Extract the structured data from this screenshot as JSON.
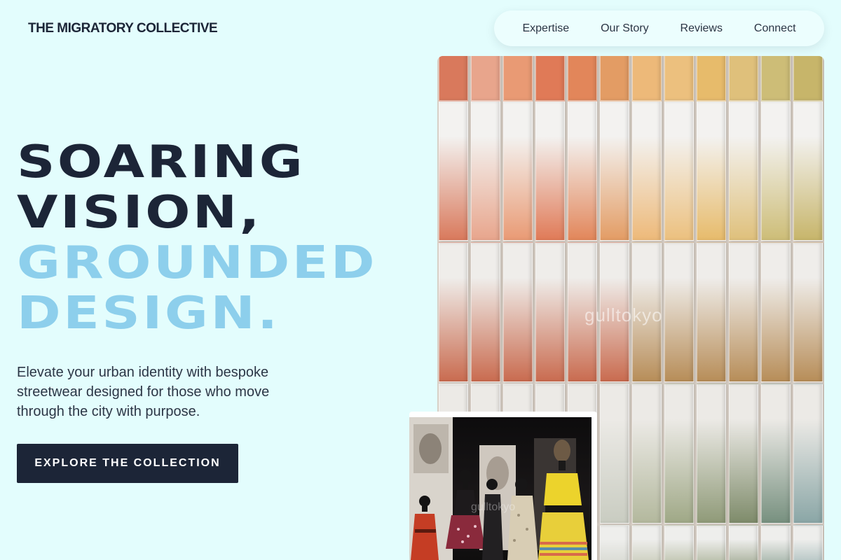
{
  "brand": "THE MIGRATORY COLLECTIVE",
  "nav": {
    "items": [
      {
        "label": "Expertise"
      },
      {
        "label": "Our Story"
      },
      {
        "label": "Reviews"
      },
      {
        "label": "Connect"
      }
    ]
  },
  "hero": {
    "line1": "SOARING",
    "line2": "VISION,",
    "line3": "GROUNDED",
    "line4": "DESIGN.",
    "subtext": "Elevate your urban identity with bespoke streetwear designed for those who move through the city with purpose.",
    "cta_label": "EXPLORE THE COLLECTION"
  },
  "images": {
    "main_watermark": "gulltokyo",
    "secondary_watermark": "gulltokyo"
  },
  "colors": {
    "background": "#e3fdfd",
    "dark": "#1c2537",
    "accent": "#8dcfec"
  }
}
